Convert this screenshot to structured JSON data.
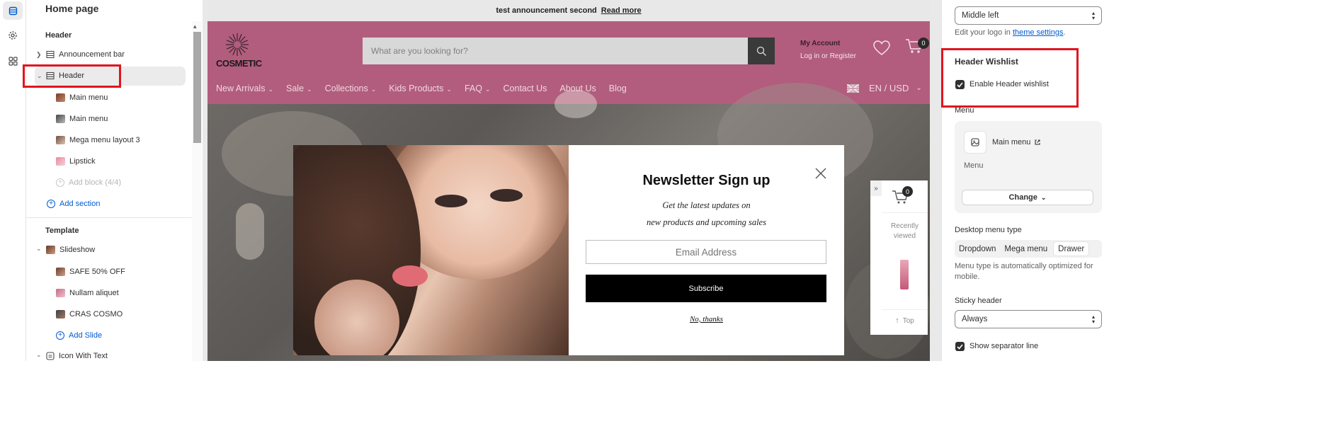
{
  "rail": {
    "icons": [
      "sections-icon",
      "settings-gear-icon",
      "apps-icon"
    ]
  },
  "left": {
    "title": "Home page",
    "header_group": "Header",
    "items": {
      "announcement_bar": "Announcement bar",
      "header": "Header",
      "main_menu_1": "Main menu",
      "main_menu_2": "Main menu",
      "mega_menu": "Mega menu layout 3",
      "lipstick": "Lipstick",
      "add_block": "Add block (4/4)",
      "add_section": "Add section"
    },
    "template_group": "Template",
    "template_items": {
      "slideshow": "Slideshow",
      "safe": "SAFE 50% OFF",
      "nullam": "Nullam aliquet",
      "cras": "CRAS COSMO",
      "add_slide": "Add Slide",
      "icon_with_text": "Icon With Text"
    }
  },
  "preview": {
    "announcement": {
      "text": "test announcement second",
      "link": "Read more"
    },
    "logo_text": "COSMETIC",
    "search_placeholder": "What are you looking for?",
    "account": {
      "title": "My Account",
      "links": "Log in or Register"
    },
    "cart_count": "0",
    "nav": [
      "New Arrivals",
      "Sale",
      "Collections",
      "Kids Products",
      "FAQ",
      "Contact Us",
      "About Us",
      "Blog"
    ],
    "nav_has_caret": [
      true,
      true,
      true,
      true,
      true,
      false,
      false,
      false
    ],
    "currency": "EN / USD",
    "newsletter": {
      "title": "Newsletter Sign up",
      "subtitle_line1": "Get the latest updates on",
      "subtitle_line2": "new products and upcoming sales",
      "email_placeholder": "Email Address",
      "subscribe": "Subscribe",
      "no_thanks": "No, thanks"
    },
    "sidebar_widget": {
      "cart_count": "0",
      "recently": "Recently",
      "viewed": "viewed",
      "top": "Top"
    }
  },
  "right": {
    "logo_position": "Middle left",
    "logo_help_prefix": "Edit your logo in ",
    "logo_help_link": "theme settings",
    "logo_help_suffix": ".",
    "wishlist_heading": "Header Wishlist",
    "wishlist_checkbox": "Enable Header wishlist",
    "menu_label": "Menu",
    "menu_name": "Main menu",
    "menu_sub": "Menu",
    "change_button": "Change",
    "desktop_menu_type_label": "Desktop menu type",
    "menu_types": [
      "Dropdown",
      "Mega menu",
      "Drawer"
    ],
    "menu_type_selected": "Drawer",
    "menu_type_help_1": "Menu type is automatically optimized for",
    "menu_type_help_2": "mobile.",
    "sticky_label": "Sticky header",
    "sticky_value": "Always",
    "separator_label": "Show separator line"
  },
  "colors": {
    "header_bg": "#b25d7d",
    "link": "#005bd3",
    "highlight": "#e0141e"
  }
}
